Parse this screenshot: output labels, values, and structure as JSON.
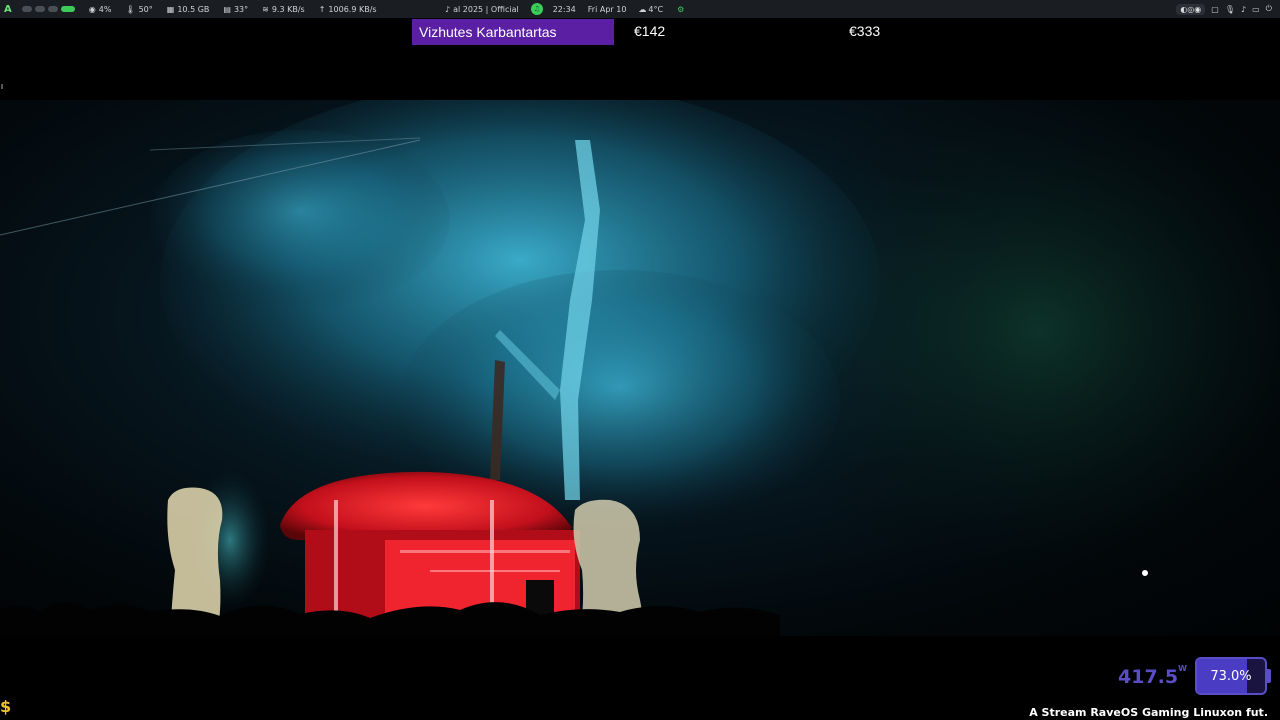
{
  "topbar": {
    "app_icon": "app-logo-icon",
    "workspaces": 4,
    "active_workspace": 4,
    "cpu": "4%",
    "temp_cpu": "50°",
    "memory": "10.5 GB",
    "temp_gpu": "33°",
    "net_down": "9.3 KB/s",
    "net_up": "1006.9 KB/s",
    "media_title": "al 2025 | Official",
    "time": "22:34",
    "date": "Fri Apr 10",
    "weather": "4°C"
  },
  "ticker": {
    "name": "Vizhutes Karbantartas",
    "price_1": "€142",
    "price_2": "€333",
    "accent": "#5a1fa3"
  },
  "overlay": {
    "power_value": "417.5",
    "power_unit": "W",
    "battery_text": "73.0%",
    "battery_level": 0.73,
    "caption": "A Stream RaveOS Gaming Linuxon fut.",
    "accent": "#5a4dc8"
  },
  "video": {
    "scene": "night-festival-tree-stage",
    "colors": {
      "tree": "#2fa3c4",
      "stage": "#e0202a"
    }
  }
}
